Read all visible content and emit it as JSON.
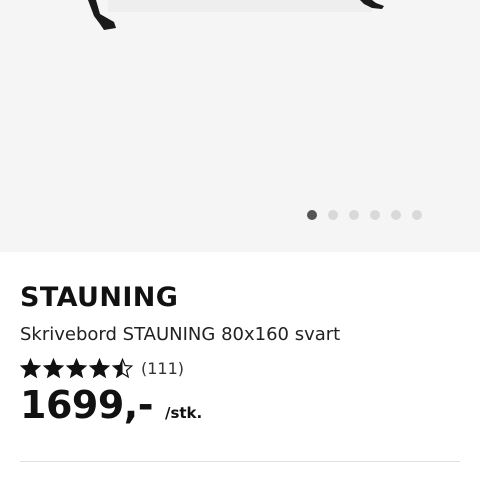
{
  "product": {
    "brand": "STAUNING",
    "description": "Skrivebord STAUNING 80x160 svart",
    "rating": 4.5,
    "review_count": "(111)",
    "price": "1699,-",
    "unit": "/stk."
  },
  "carousel": {
    "total_images": 6,
    "active_index": 0
  },
  "colors": {
    "hero_bg": "#f5f5f5",
    "dot_active": "#555555",
    "dot_inactive": "#d9d9d9",
    "text": "#111111"
  }
}
